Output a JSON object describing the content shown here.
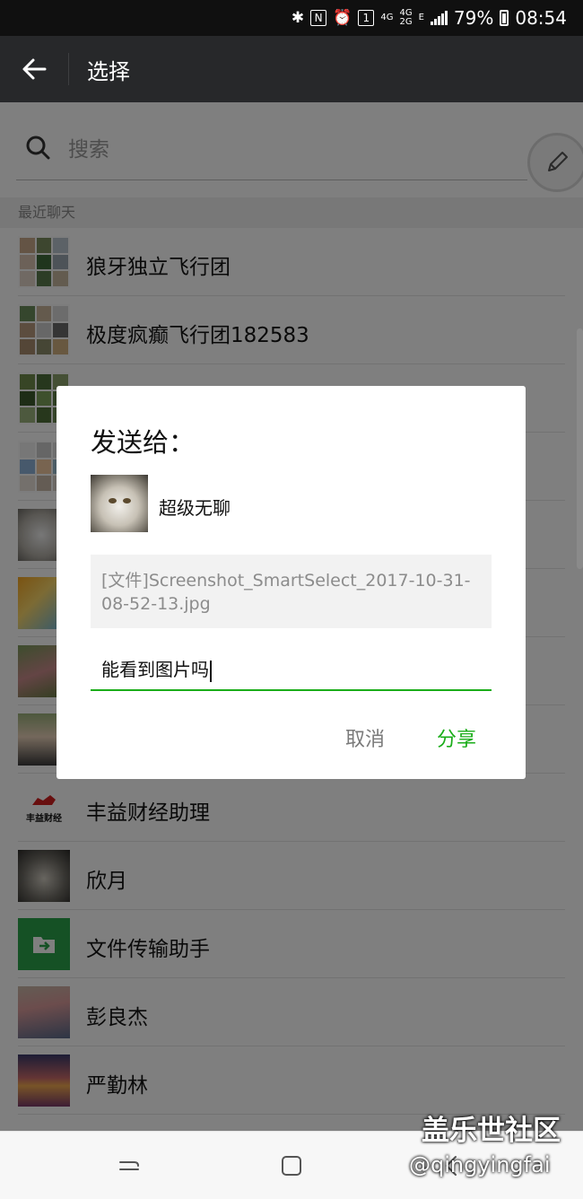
{
  "status_bar": {
    "battery_percent": "79%",
    "time": "08:54",
    "sim_slot": "1",
    "net1": "4G",
    "net2_top": "4G",
    "net2_bottom": "2G",
    "edge": "E"
  },
  "header": {
    "title": "选择"
  },
  "search": {
    "placeholder": "搜索"
  },
  "section": {
    "recent_label": "最近聊天"
  },
  "chats": [
    {
      "name": "狼牙独立飞行团",
      "avatar": "group-photo-grid"
    },
    {
      "name": "极度疯癫飞行团182583",
      "avatar": "group-photo-grid"
    },
    {
      "name": "",
      "avatar": "group-photo-grid"
    },
    {
      "name": "",
      "avatar": "group-photo-grid"
    },
    {
      "name": "",
      "avatar": "cat-photo"
    },
    {
      "name": "",
      "avatar": "cartoon-photo"
    },
    {
      "name": "",
      "avatar": "flower-photo"
    },
    {
      "name": "",
      "avatar": "person-photo"
    },
    {
      "name": "丰益财经助理",
      "avatar": "brand-logo",
      "logo_text": "丰益财经"
    },
    {
      "name": "欣月",
      "avatar": "cat-photo"
    },
    {
      "name": "文件传输助手",
      "avatar": "folder-icon",
      "color": "#2aa24a"
    },
    {
      "name": "彭良杰",
      "avatar": "child-photo"
    },
    {
      "name": "严勤林",
      "avatar": "sunset-photo"
    }
  ],
  "dialog": {
    "title": "发送给：",
    "recipient_name": "超级无聊",
    "file_text": "[文件]Screenshot_SmartSelect_2017-10-31-08-52-13.jpg",
    "message": "能看到图片吗",
    "cancel_label": "取消",
    "share_label": "分享",
    "accent_color": "#1aad19"
  },
  "watermark": {
    "line1": "盖乐世社区",
    "line2": "@qingyingfai"
  }
}
